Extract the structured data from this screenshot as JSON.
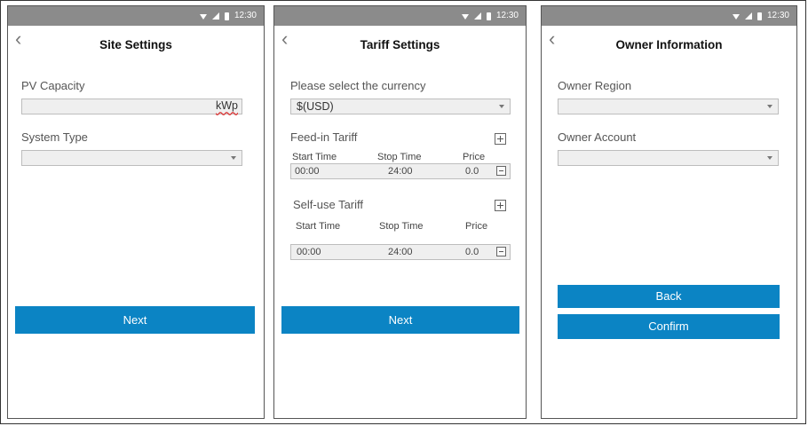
{
  "status_time": "12:30",
  "colors": {
    "accent": "#0b84c4",
    "status_bar": "#8b8b8b",
    "field_bg": "#efefef"
  },
  "screens": {
    "site": {
      "title": "Site Settings",
      "pv_capacity_label": "PV Capacity",
      "pv_capacity_value": "",
      "pv_unit": "kWp",
      "system_type_label": "System Type",
      "system_type_value": "",
      "next_label": "Next"
    },
    "tariff": {
      "title": "Tariff Settings",
      "currency_label": "Please select the currency",
      "currency_value": "$(USD)",
      "feed_in": {
        "label": "Feed-in Tariff",
        "headers": [
          "Start Time",
          "Stop Time",
          "Price"
        ],
        "rows": [
          {
            "start": "00:00",
            "stop": "24:00",
            "price": "0.0"
          }
        ]
      },
      "self_use": {
        "label": "Self-use Tariff",
        "headers": [
          "Start Time",
          "Stop Time",
          "Price"
        ],
        "rows": [
          {
            "start": "00:00",
            "stop": "24:00",
            "price": "0.0"
          }
        ]
      },
      "next_label": "Next"
    },
    "owner": {
      "title": "Owner Information",
      "region_label": "Owner Region",
      "region_value": "",
      "account_label": "Owner Account",
      "account_value": "",
      "back_label": "Back",
      "confirm_label": "Confirm"
    }
  }
}
